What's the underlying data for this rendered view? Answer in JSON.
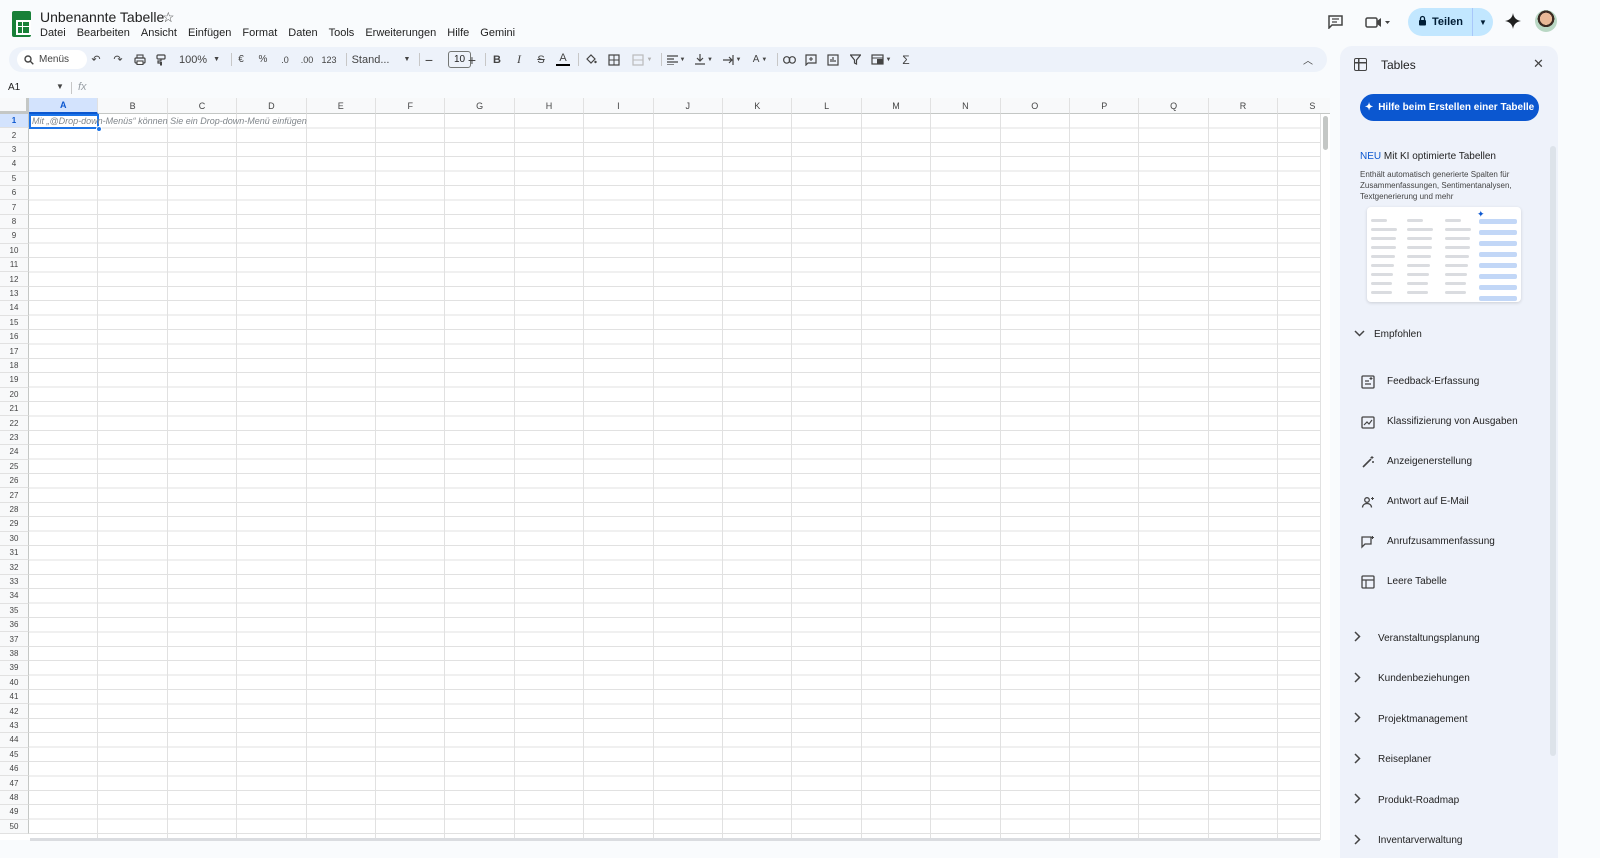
{
  "document": {
    "title": "Unbenannte Tabelle"
  },
  "menu": [
    "Datei",
    "Bearbeiten",
    "Ansicht",
    "Einfügen",
    "Format",
    "Daten",
    "Tools",
    "Erweiterungen",
    "Hilfe",
    "Gemini"
  ],
  "header": {
    "share_label": "Teilen"
  },
  "toolbar": {
    "search_label": "Menüs",
    "zoom": "100%",
    "currency": "€",
    "percent": "%",
    "decrease_decimal": ".0",
    "increase_decimal": ".00",
    "number_format": "123",
    "font": "Stand...",
    "font_size": "10",
    "bold": "B",
    "italic": "I",
    "sum": "Σ"
  },
  "formula_bar": {
    "cell_ref": "A1",
    "fx": "fx"
  },
  "grid": {
    "columns": [
      "A",
      "B",
      "C",
      "D",
      "E",
      "F",
      "G",
      "H",
      "I",
      "J",
      "K",
      "L",
      "M",
      "N",
      "O",
      "P",
      "Q",
      "R",
      "S"
    ],
    "rows": 50,
    "cell_hint": "Mit „@Drop-down-Menüs“ können Sie ein Drop-down-Menü einfügen"
  },
  "panel": {
    "title": "Tables",
    "help_button": "Hilfe beim Erstellen einer Tabelle",
    "new_badge": "NEU",
    "new_title": "Mit KI optimierte Tabellen",
    "new_desc": "Enthält automatisch generierte Spalten für Zusammenfassungen, Sentimentanalysen, Textgenerierung und mehr",
    "recommended_label": "Empfohlen",
    "templates": [
      {
        "label": "Feedback-Erfassung",
        "icon": "feedback-icon"
      },
      {
        "label": "Klassifizierung von Ausgaben",
        "icon": "chart-sparkle-icon"
      },
      {
        "label": "Anzeigenerstellung",
        "icon": "magic-wand-icon"
      },
      {
        "label": "Antwort auf E-Mail",
        "icon": "person-sparkle-icon"
      },
      {
        "label": "Anrufzusammenfassung",
        "icon": "chat-sparkle-icon"
      },
      {
        "label": "Leere Tabelle",
        "icon": "table-icon"
      }
    ],
    "categories": [
      "Veranstaltungsplanung",
      "Kundenbeziehungen",
      "Projektmanagement",
      "Reiseplaner",
      "Produkt-Roadmap",
      "Inventarverwaltung"
    ]
  },
  "colors": {
    "accent": "#0b57d0",
    "share_bg": "#c2e7ff",
    "panel_bg": "#eef2fa",
    "sheets_green": "#188038"
  }
}
